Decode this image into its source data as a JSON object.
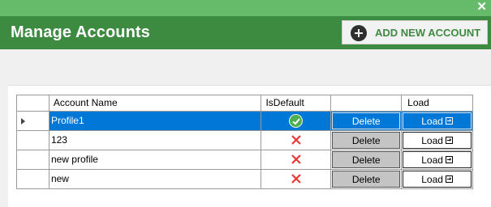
{
  "window": {
    "close_glyph": "✕"
  },
  "header": {
    "title": "Manage Accounts",
    "add_button_label": "ADD NEW ACCOUNT",
    "add_icon": "plus-circle-icon"
  },
  "grid": {
    "columns": [
      "",
      "Account Name",
      "IsDefault",
      "",
      "Load"
    ],
    "rows": [
      {
        "name": "Profile1",
        "is_default": true,
        "delete_label": "Delete",
        "load_label": "Load",
        "selected": true
      },
      {
        "name": "123",
        "is_default": false,
        "delete_label": "Delete",
        "load_label": "Load",
        "selected": false
      },
      {
        "name": "new profile",
        "is_default": false,
        "delete_label": "Delete",
        "load_label": "Load",
        "selected": false
      },
      {
        "name": "new",
        "is_default": false,
        "delete_label": "Delete",
        "load_label": "Load",
        "selected": false
      }
    ]
  },
  "colors": {
    "brand_green": "#3d8b40",
    "light_green": "#66bb6a",
    "selection": "#0078d7",
    "check": "#4caf50",
    "cross": "#e53935"
  }
}
